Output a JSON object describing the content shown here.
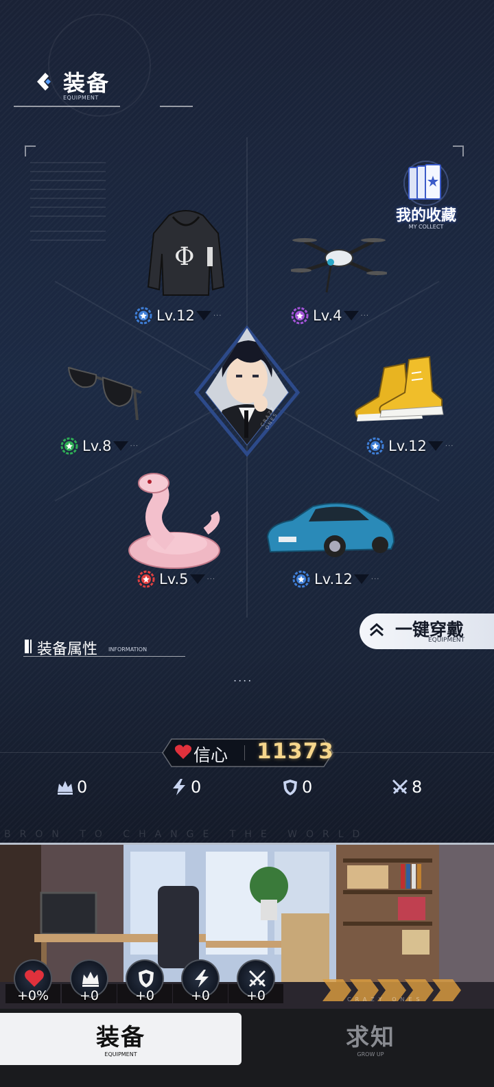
{
  "header": {
    "title": "装备",
    "subtitle": "EQUIPMENT"
  },
  "collection": {
    "label": "我的收藏",
    "sublabel": "MY COLLECT"
  },
  "items": [
    {
      "name": "hoodie",
      "level": "Lv.12",
      "badge_color": "#3f7fd8"
    },
    {
      "name": "drone",
      "level": "Lv.4",
      "badge_color": "#a454d8"
    },
    {
      "name": "sunglasses",
      "level": "Lv.8",
      "badge_color": "#2fae56"
    },
    {
      "name": "sneakers",
      "level": "Lv.12",
      "badge_color": "#3f7fd8"
    },
    {
      "name": "cobra",
      "level": "Lv.5",
      "badge_color": "#e04040"
    },
    {
      "name": "car",
      "level": "Lv.12",
      "badge_color": "#3f7fd8"
    }
  ],
  "avatar_caption": "CRAZY ONES",
  "one_key": {
    "label": "一键穿戴",
    "sublabel": "EQUIPMENT"
  },
  "info": {
    "title": "装备属性",
    "subtitle": "INFORMATION",
    "more": "...."
  },
  "confidence": {
    "label": "信心",
    "value": "11373"
  },
  "stats": [
    {
      "icon": "crown-icon",
      "value": "0"
    },
    {
      "icon": "lightning-icon",
      "value": "0"
    },
    {
      "icon": "shield-icon",
      "value": "0"
    },
    {
      "icon": "swords-icon",
      "value": "8"
    }
  ],
  "tagline": "BRON TO CHANGE THE WORLD",
  "buffs": [
    {
      "icon": "heart-icon",
      "value": "+0%"
    },
    {
      "icon": "crown-icon",
      "value": "+0"
    },
    {
      "icon": "shield-icon",
      "value": "+0"
    },
    {
      "icon": "lightning-icon",
      "value": "+0"
    },
    {
      "icon": "swords-icon",
      "value": "+0"
    }
  ],
  "scene_caption": "CRAZY ONES",
  "tabs": [
    {
      "label": "装备",
      "sublabel": "EQUIPMENT",
      "active": true
    },
    {
      "label": "求知",
      "sublabel": "GROW UP",
      "active": false
    }
  ],
  "colors": {
    "accent_gold": "#f6d68c",
    "heart_red": "#e0313c"
  }
}
